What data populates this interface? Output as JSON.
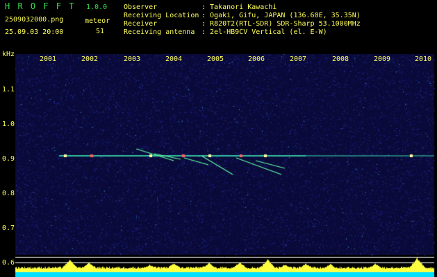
{
  "app": {
    "title": "H R O F F T",
    "version": "1.0.0",
    "filename": "2509032000.png",
    "datetime": "25.09.03 20:00",
    "meteor_label": "meteor",
    "meteor_count": "51"
  },
  "info": {
    "observer_label": "Observer",
    "observer_value": ": Takanori Kawachi",
    "location_label": "Receiving Location",
    "location_value": ": Ogaki, Gifu, JAPAN (136.60E, 35.35N)",
    "receiver_label": "Receiver",
    "receiver_value": ": R820T2(RTL-SDR) SDR-Sharp 53.1000MHz",
    "antenna_label": "Receiving antenna",
    "antenna_value": ": 2el-HB9CV Vertical (el. E-W)"
  },
  "axis": {
    "y_unit": "kHz",
    "y_ticks": [
      "1.1",
      "1.0",
      "0.9",
      "0.8",
      "0.7",
      "0.6"
    ],
    "x_ticks": [
      "2001",
      "2002",
      "2003",
      "2004",
      "2005",
      "2006",
      "2007",
      "2008",
      "2009",
      "2010"
    ]
  },
  "colors": {
    "background": "#000000",
    "spectrogram_base": "#0a0a3a",
    "noise_speck": "#3040c0",
    "carrier": "#40ffc0",
    "meteor_trail": "#60ffa0",
    "meteor_head": "#ff6060",
    "grid_lines": "#ffffff",
    "histogram_fill": "#ffff40",
    "cyan_band": "#00e0ff",
    "header_green": "#35e04a",
    "header_yellow": "#ffff5a"
  }
}
